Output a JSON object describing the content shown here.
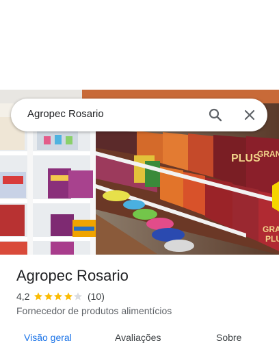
{
  "search": {
    "query": "Agropec Rosario"
  },
  "place": {
    "name": "Agropec Rosario",
    "rating": "4,2",
    "rating_value": 4.2,
    "review_count": "(10)",
    "category": "Fornecedor de produtos alimentícios"
  },
  "tabs": [
    {
      "label": "Visão geral",
      "active": true
    },
    {
      "label": "Avaliações",
      "active": false
    },
    {
      "label": "Sobre",
      "active": false
    }
  ],
  "colors": {
    "accent": "#1a73e8",
    "star": "#fbbc04",
    "star_empty": "#dadce0"
  },
  "icons": [
    "search-icon",
    "close-icon",
    "star-icon"
  ]
}
